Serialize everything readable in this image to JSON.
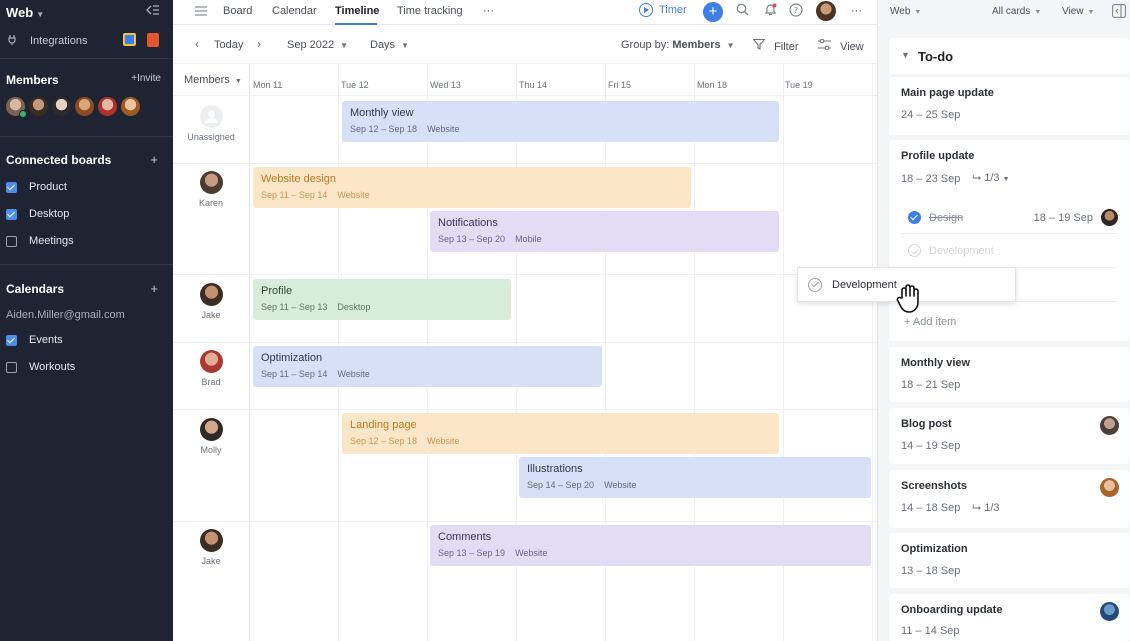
{
  "sidebar": {
    "workspace": "Web",
    "integrations_label": "Integrations",
    "members_title": "Members",
    "invite_label": "+Invite",
    "connected_title": "Connected boards",
    "boards": [
      {
        "label": "Product",
        "checked": true
      },
      {
        "label": "Desktop",
        "checked": true
      },
      {
        "label": "Meetings",
        "checked": false
      }
    ],
    "calendars_title": "Calendars",
    "account": "Aiden.Miller@gmail.com",
    "calendars": [
      {
        "label": "Events",
        "checked": true
      },
      {
        "label": "Workouts",
        "checked": false
      }
    ]
  },
  "topbar": {
    "tabs": [
      "Board",
      "Calendar",
      "Timeline",
      "Time tracking"
    ],
    "active_tab": "Timeline",
    "more": "···",
    "timer_label": "Timer"
  },
  "toolbar": {
    "today": "Today",
    "month": "Sep 2022",
    "scale": "Days",
    "group_by_prefix": "Group by:",
    "group_by_value": "Members",
    "filter": "Filter",
    "view": "View"
  },
  "timeline": {
    "members_header": "Members",
    "days": [
      "Mon 11",
      "Tue 12",
      "Wed 13",
      "Thu 14",
      "Fri 15",
      "Mon 18",
      "Tue 19"
    ],
    "rows": [
      {
        "name": "Unassigned"
      },
      {
        "name": "Karen"
      },
      {
        "name": "Jake"
      },
      {
        "name": "Brad"
      },
      {
        "name": "Molly"
      },
      {
        "name": "Jake"
      }
    ],
    "bars": [
      {
        "title": "Monthly view",
        "dates": "Sep 12 – Sep 18",
        "board": "Website"
      },
      {
        "title": "Website design",
        "dates": "Sep 11 – Sep 14",
        "board": "Website"
      },
      {
        "title": "Notifications",
        "dates": "Sep 13 – Sep 20",
        "board": "Mobile"
      },
      {
        "title": "Profile",
        "dates": "Sep 11 – Sep 13",
        "board": "Desktop"
      },
      {
        "title": "Optimization",
        "dates": "Sep 11 – Sep 14",
        "board": "Website"
      },
      {
        "title": "Landing page",
        "dates": "Sep 12 – Sep 18",
        "board": "Website"
      },
      {
        "title": "Illustrations",
        "dates": "Sep 14 – Sep 20",
        "board": "Website"
      },
      {
        "title": "Comments",
        "dates": "Sep 13 – Sep 19",
        "board": "Website"
      }
    ]
  },
  "right_panel": {
    "board": "Web",
    "filter": "All cards",
    "view": "View",
    "column_title": "To-do",
    "cards": [
      {
        "title": "Main page update",
        "dates": "24 – 25 Sep"
      },
      {
        "title": "Profile update",
        "dates": "18 – 23 Sep",
        "subtasks": "1/3",
        "items": [
          {
            "label": "Design",
            "dates": "18 – 19 Sep",
            "done": true
          },
          {
            "label": "Development",
            "done": false
          }
        ],
        "add_item": "+ Add item"
      },
      {
        "title": "Monthly view",
        "dates": "18 – 21 Sep"
      },
      {
        "title": "Blog post",
        "dates": "14 – 19 Sep"
      },
      {
        "title": "Screenshots",
        "dates": "14 – 18 Sep",
        "subtasks": "1/3"
      },
      {
        "title": "Optimization",
        "dates": "13 – 18 Sep"
      },
      {
        "title": "Onboarding update",
        "dates": "11 – 14 Sep"
      }
    ]
  },
  "drag_ghost": {
    "label": "Development"
  },
  "colors": {
    "accent": "#3d7fe6",
    "sidebar_bg": "#1f2433",
    "blue_bar": "#d6e1f7",
    "orange_bar": "#fce6c8",
    "purple_bar": "#e2dcf5",
    "green_bar": "#d7ecd9"
  }
}
